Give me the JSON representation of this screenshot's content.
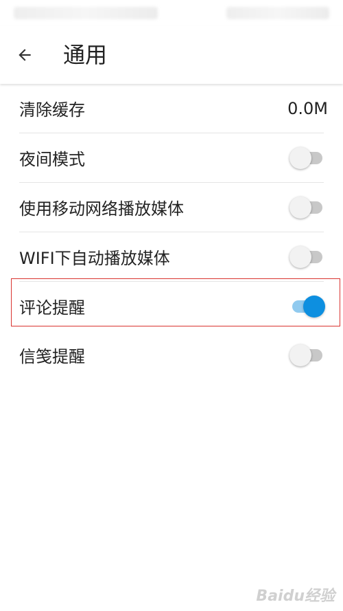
{
  "app_bar": {
    "title": "通用",
    "back_icon": "arrow-left-icon"
  },
  "settings": [
    {
      "key": "clear_cache",
      "label": "清除缓存",
      "type": "value",
      "value": "0.0M"
    },
    {
      "key": "night_mode",
      "label": "夜间模式",
      "type": "toggle",
      "on": false
    },
    {
      "key": "mobile_media",
      "label": "使用移动网络播放媒体",
      "type": "toggle",
      "on": false
    },
    {
      "key": "wifi_autoplay",
      "label": "WIFI下自动播放媒体",
      "type": "toggle",
      "on": false
    },
    {
      "key": "comment_reminder",
      "label": "评论提醒",
      "type": "toggle",
      "on": true
    },
    {
      "key": "letter_reminder",
      "label": "信笺提醒",
      "type": "toggle",
      "on": false
    }
  ],
  "highlight": {
    "target": "comment_reminder",
    "color": "#d9322e"
  },
  "colors": {
    "toggle_on_thumb": "#0d8fe0",
    "toggle_on_track": "#90caef",
    "toggle_off_thumb": "#f2f2f2",
    "toggle_off_track": "#c8c8c8"
  },
  "watermark": "Baidu经验"
}
